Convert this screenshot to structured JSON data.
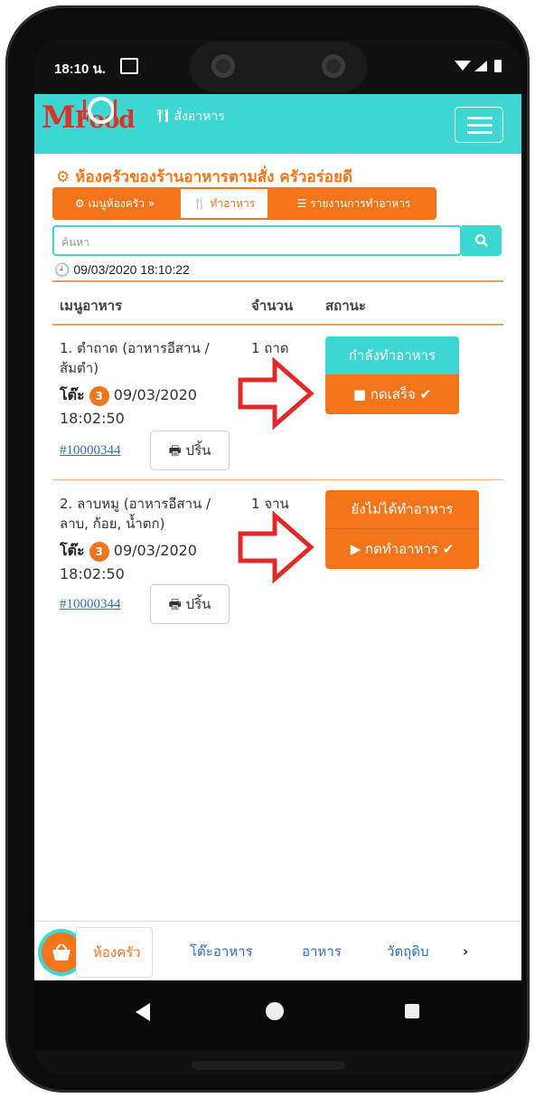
{
  "status_bar": {
    "time": "18:10 น."
  },
  "header": {
    "order_link": "สั่งอาหาร",
    "logo_m": "M",
    "logo_food": "Food"
  },
  "page": {
    "title": "ห้องครัวของร้านอาหารตามสั่ง ครัวอร่อยดี"
  },
  "tabs": [
    {
      "label": "เมนูห้องครัว »"
    },
    {
      "label": "ทำอาหาร"
    },
    {
      "label": "รายงานการทำอาหาร"
    }
  ],
  "search": {
    "placeholder": "ค้นหา"
  },
  "datetime": "09/03/2020 18:10:22",
  "table": {
    "headers": {
      "menu": "เมนูอาหาร",
      "qty": "จำนวน",
      "status": "สถานะ"
    },
    "rows": [
      {
        "menu_line1": "1. ตำถาด (อาหารอีสาน /",
        "menu_line2": "ส้มตำ)",
        "qty": "1 ถาด",
        "table_label": "โต๊ะ",
        "table_no": "3",
        "date": "09/03/2020",
        "time": "18:02:50",
        "order_id": "#10000344",
        "print_label": "ปริ้น",
        "status_label": "กำลังทำอาหาร",
        "action_label": "กดเสร็จ",
        "status_color": "#3ed6d2"
      },
      {
        "menu_line1": "2. ลาบหมู (อาหารอีสาน /",
        "menu_line2": "ลาบ, ก้อย, น้ำตก)",
        "qty": "1 จาน",
        "table_label": "โต๊ะ",
        "table_no": "3",
        "date": "09/03/2020",
        "time": "18:02:50",
        "order_id": "#10000344",
        "print_label": "ปริ้น",
        "status_label": "ยังไม่ได้ทำอาหาร",
        "action_label": "กดทำอาหาร",
        "status_color": "#f2751b"
      }
    ]
  },
  "bottom_nav": [
    {
      "label": "ห้องครัว"
    },
    {
      "label": "โต๊ะอาหาร"
    },
    {
      "label": "อาหาร"
    },
    {
      "label": "วัตถุดิบ"
    }
  ],
  "colors": {
    "accent": "#f2751b",
    "teal": "#3ed6d2",
    "link": "#2f6fb7",
    "arrow": "#e02a2a"
  }
}
